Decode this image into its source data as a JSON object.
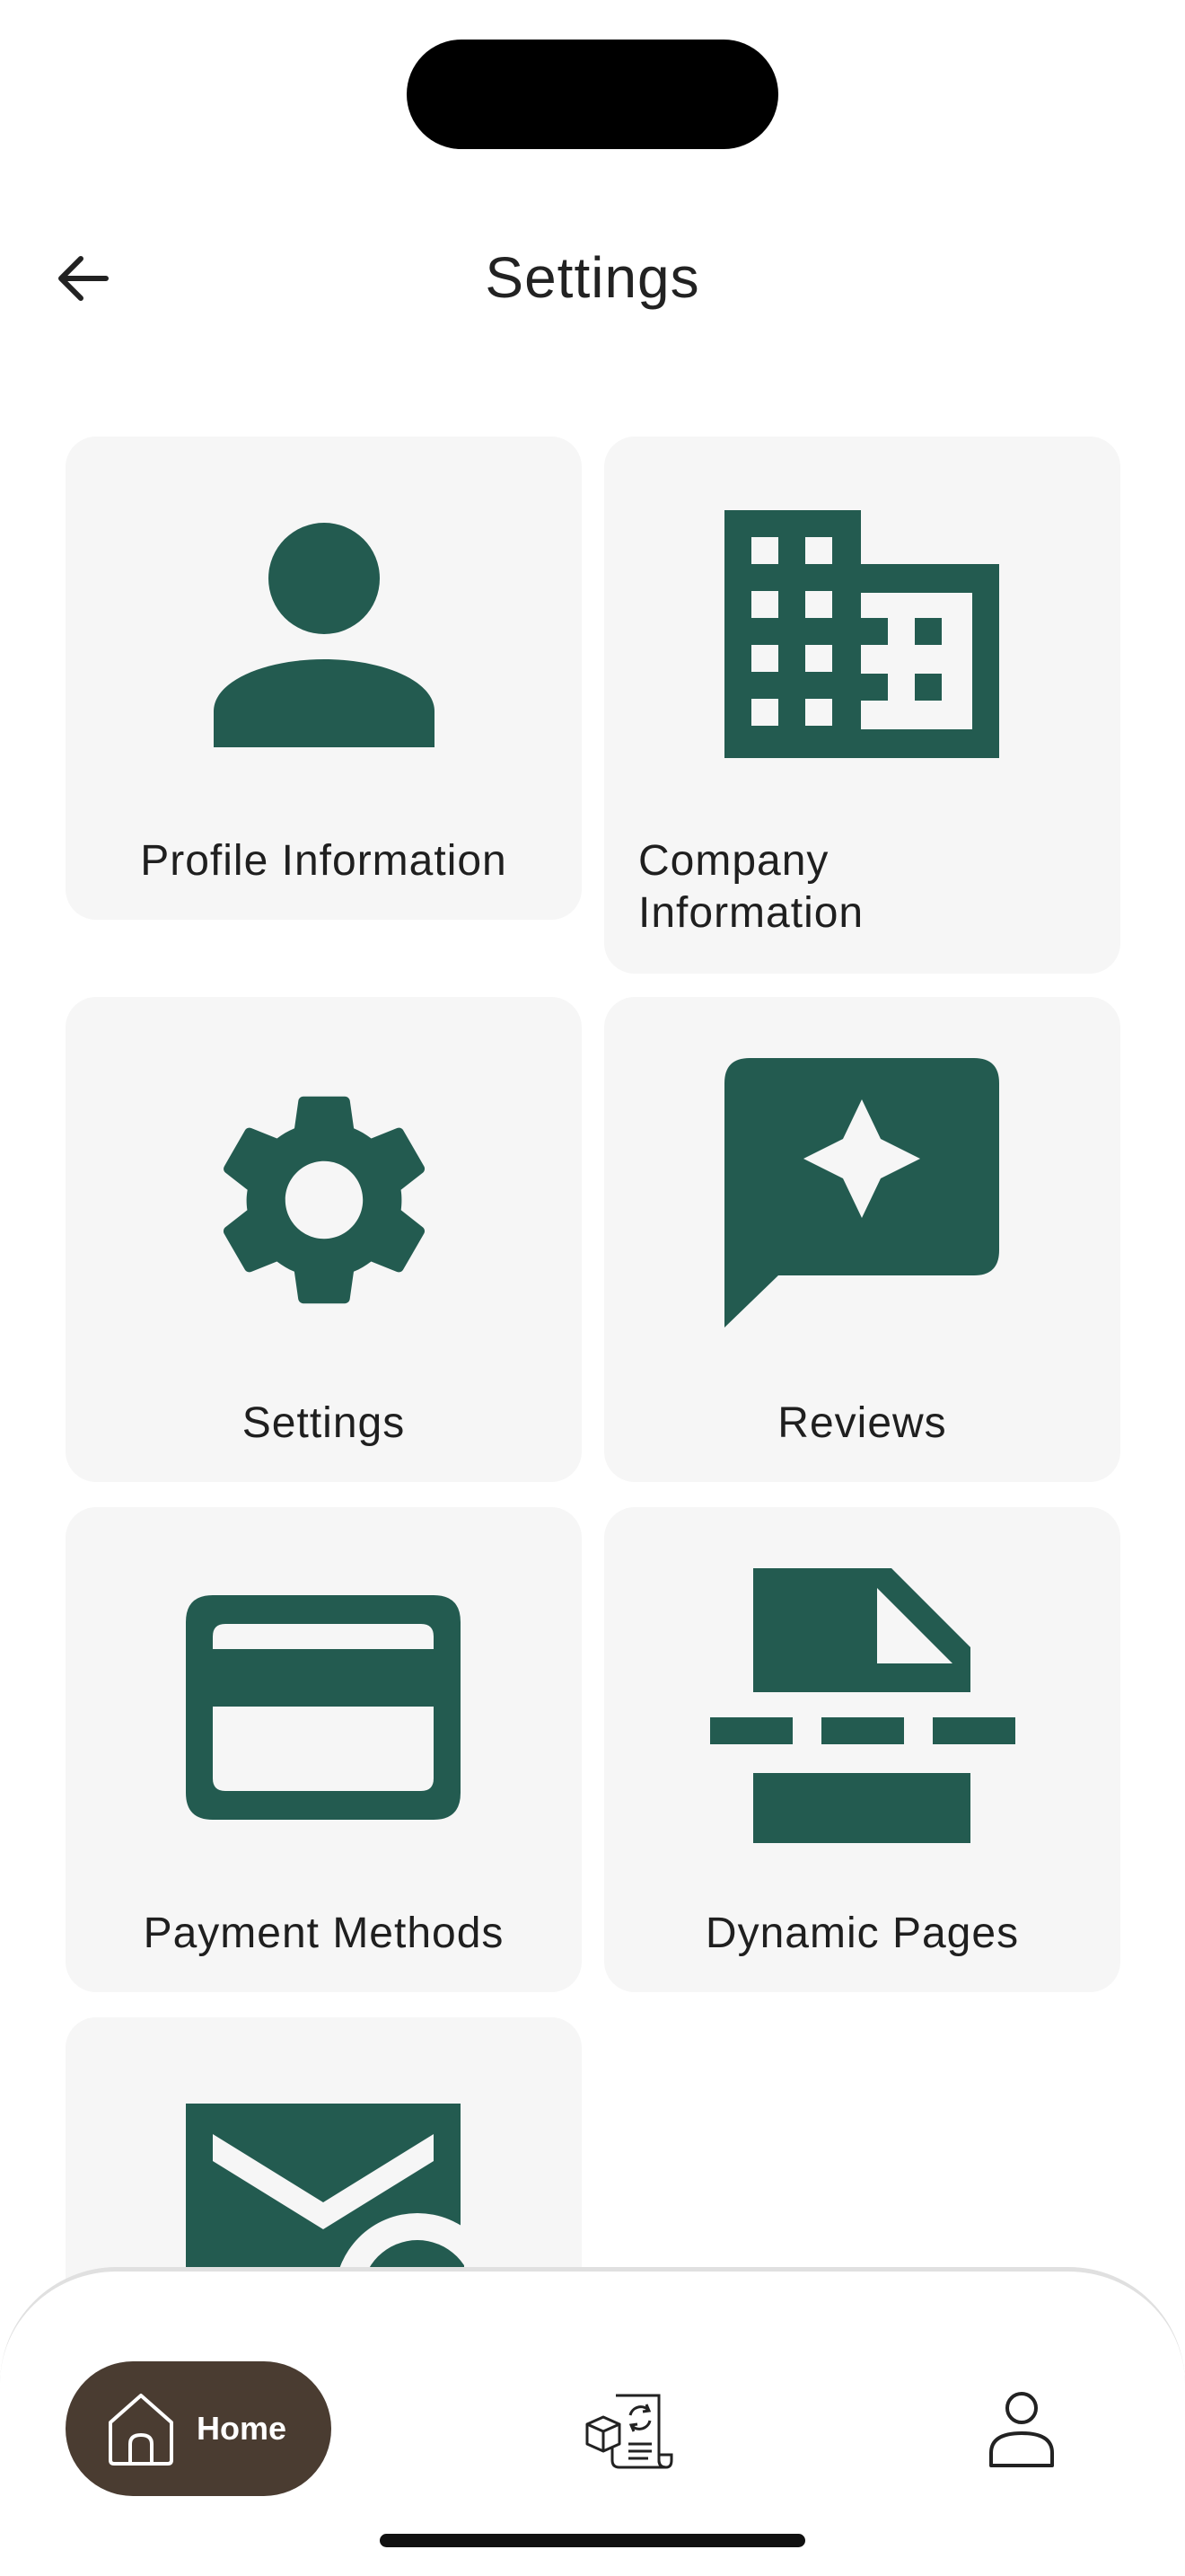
{
  "header": {
    "title": "Settings",
    "back_icon": "arrow-left-icon"
  },
  "tiles": [
    {
      "label": "Profile Information",
      "icon": "person-icon"
    },
    {
      "label": "Company Information",
      "icon": "building-icon"
    },
    {
      "label": "Settings",
      "icon": "gear-icon"
    },
    {
      "label": "Reviews",
      "icon": "review-star-chat-icon"
    },
    {
      "label": "Payment Methods",
      "icon": "credit-card-icon"
    },
    {
      "label": "Dynamic Pages",
      "icon": "dynamic-page-icon"
    },
    {
      "label": "",
      "icon": "mail-icon"
    }
  ],
  "bottom_nav": {
    "home_label": "Home",
    "items": [
      "home-icon",
      "orders-icon",
      "profile-icon"
    ]
  },
  "colors": {
    "accent": "#235b50",
    "card_bg": "#f6f6f6",
    "home_pill": "#4a3c31"
  }
}
